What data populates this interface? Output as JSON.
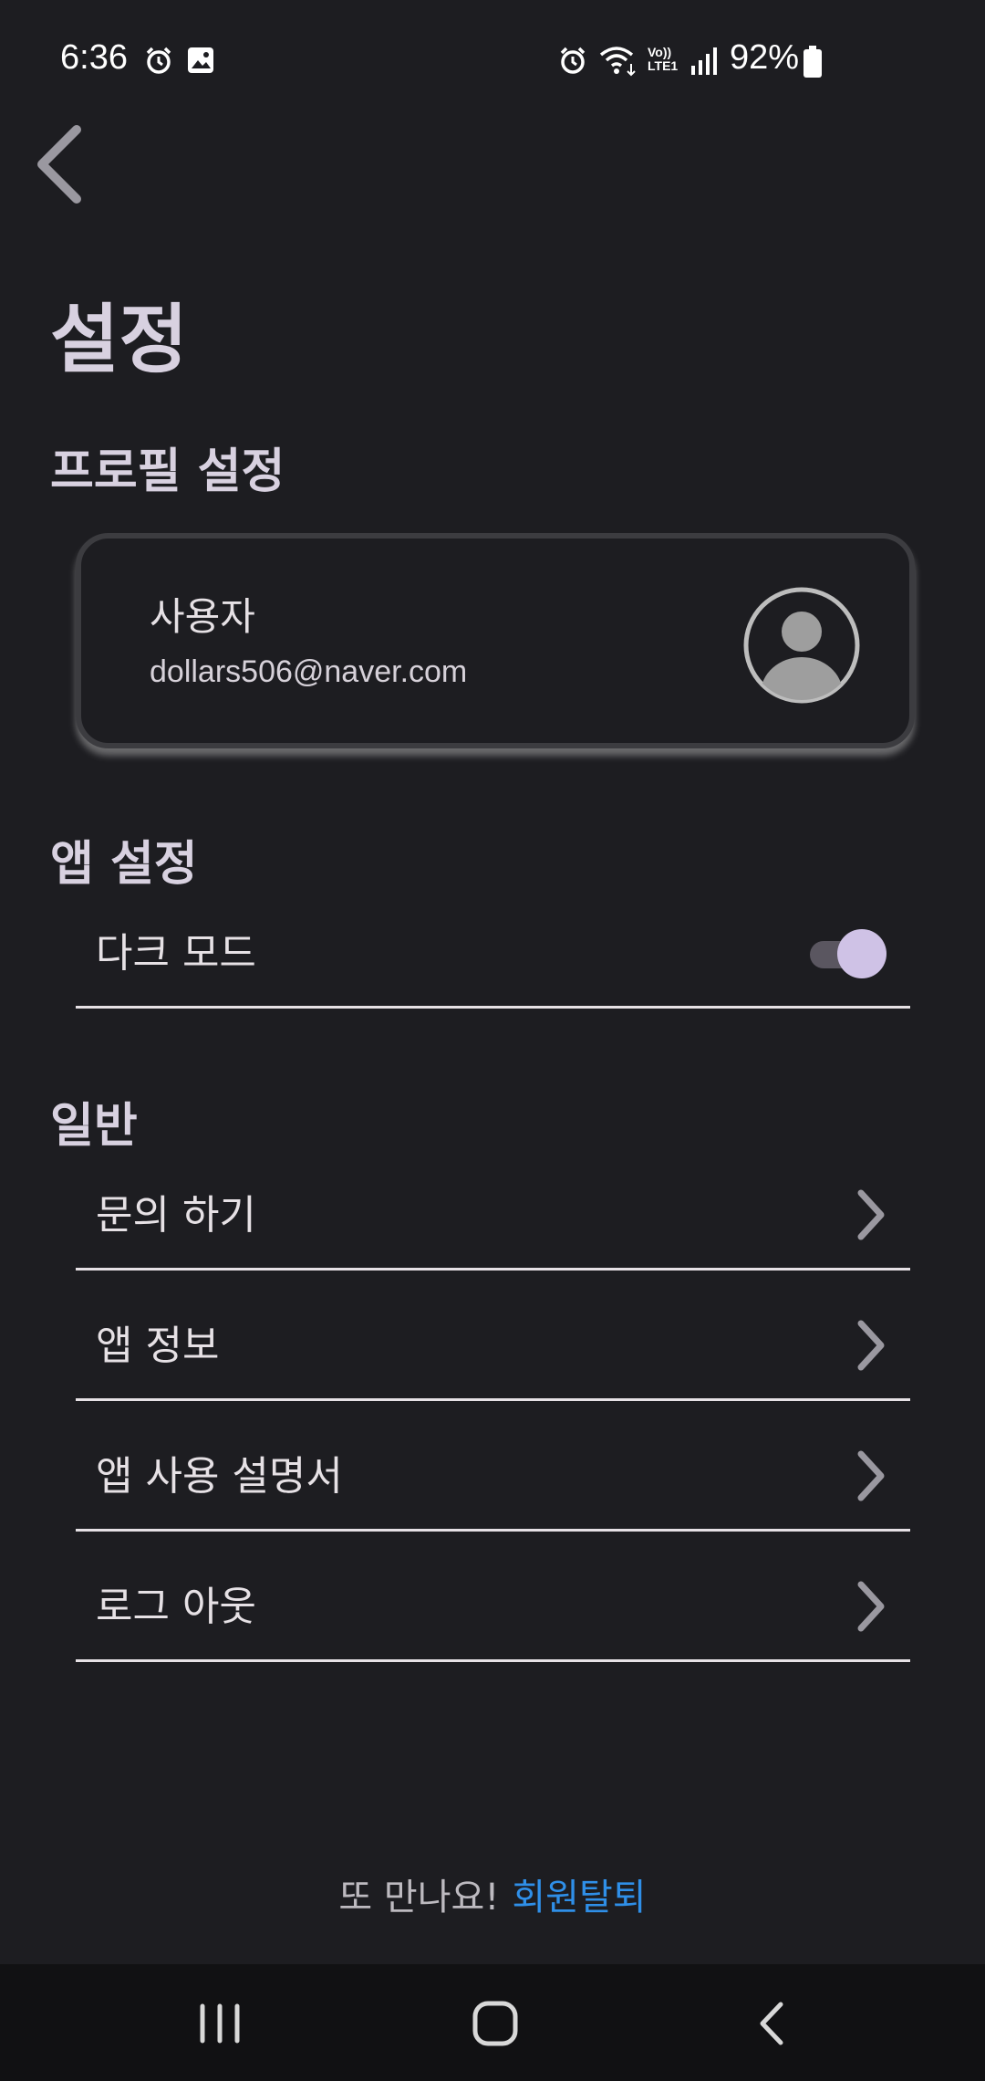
{
  "status_bar": {
    "time": "6:36",
    "battery": "92%",
    "icons": [
      "alarm-icon",
      "gallery-icon",
      "alarm-icon",
      "wifi-icon",
      "volte-lte-icon",
      "signal-icon",
      "battery-icon"
    ],
    "volte_label": "Vo)) LTE1"
  },
  "header": {
    "title": "설정"
  },
  "profile_section": {
    "title": "프로필 설정",
    "name": "사용자",
    "email": "dollars506@naver.com"
  },
  "app_section": {
    "title": "앱 설정",
    "dark_mode_label": "다크 모드",
    "dark_mode_on": true
  },
  "general_section": {
    "title": "일반",
    "items": [
      {
        "label": "문의 하기"
      },
      {
        "label": "앱 정보"
      },
      {
        "label": "앱 사용 설명서"
      },
      {
        "label": "로그 아웃"
      }
    ]
  },
  "footer": {
    "text": "또 만나요!",
    "withdraw_label": "회원탈퇴"
  },
  "colors": {
    "background": "#1d1d21",
    "accent": "#cfc2e6",
    "link": "#2f8fe8"
  }
}
